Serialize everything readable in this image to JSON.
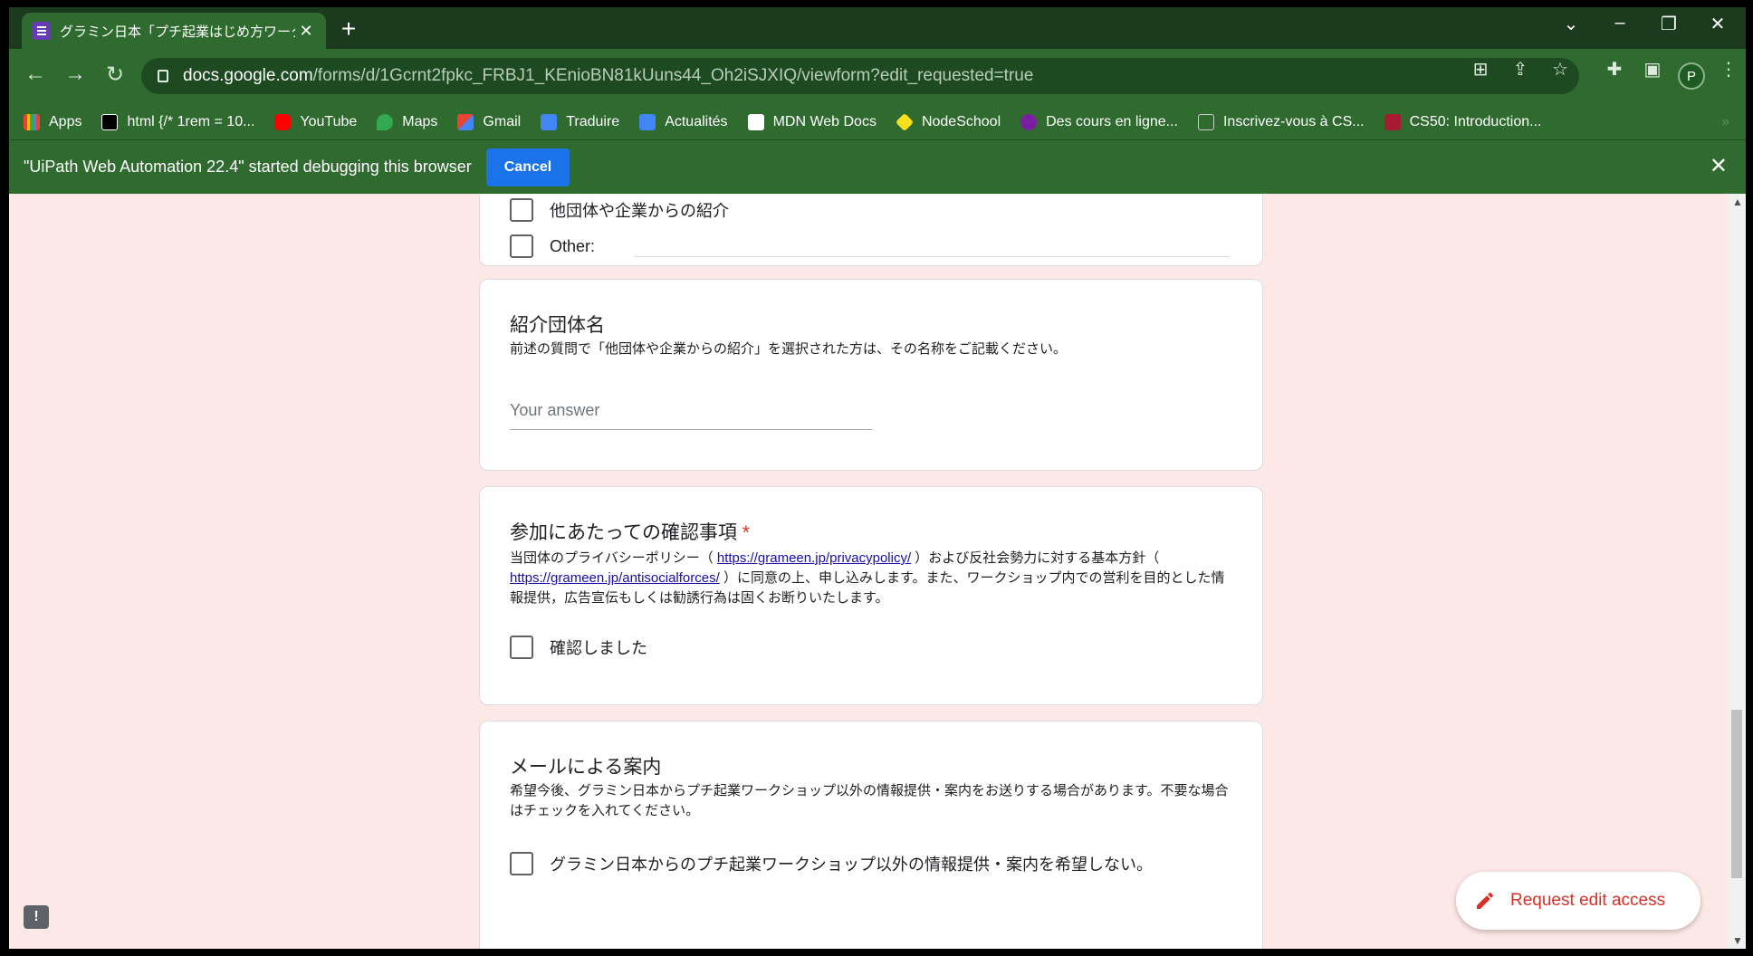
{
  "browser": {
    "tab_title": "グラミン日本「プチ起業はじめ方ワーク",
    "tab_close": "✕",
    "new_tab": "+",
    "url_host": "docs.google.com",
    "url_path": "/forms/d/1Gcrnt2fpkc_FRBJ1_KEnioBN81kUuns44_Oh2iSJXIQ/viewform?edit_requested=true",
    "profile_initial": "P",
    "icons": [
      "back-icon",
      "forward-icon",
      "reload-icon",
      "lock-icon",
      "translate-icon",
      "share-icon",
      "star-icon",
      "extensions-icon",
      "sidepanel-icon",
      "menu-icon"
    ]
  },
  "bookmarks": [
    {
      "label": "Apps",
      "color": "#ea4335"
    },
    {
      "label": "html {/* 1rem = 10...",
      "color": "#000000"
    },
    {
      "label": "YouTube",
      "color": "#ff0000"
    },
    {
      "label": "Maps",
      "color": "#34a853"
    },
    {
      "label": "Gmail",
      "color": "#ea4335"
    },
    {
      "label": "Traduire",
      "color": "#4285f4"
    },
    {
      "label": "Actualités",
      "color": "#4285f4"
    },
    {
      "label": "MDN Web Docs",
      "color": "#000000"
    },
    {
      "label": "NodeSchool",
      "color": "#f7df1e"
    },
    {
      "label": "Des cours en ligne...",
      "color": "#7b1fa2"
    },
    {
      "label": "Inscrivez-vous à CS...",
      "color": "#2f6b2f"
    },
    {
      "label": "CS50: Introduction...",
      "color": "#a51c30"
    }
  ],
  "bookmarks_more": "»",
  "infobar": {
    "message": "\"UiPath Web Automation 22.4\" started debugging this browser",
    "cancel": "Cancel",
    "close": "✕"
  },
  "form": {
    "card1": {
      "option1": "他団体や企業からの紹介",
      "other_label": "Other:"
    },
    "card2": {
      "title": "紹介団体名",
      "description": "前述の質問で「他団体や企業からの紹介」を選択された方は、その名称をご記載ください。",
      "placeholder": "Your answer"
    },
    "card3": {
      "title": "参加にあたっての確認事項",
      "required_mark": "*",
      "desc_part1": " 当団体のプライバシーポリシー（ ",
      "link1": "https://grameen.jp/privacypolicy/",
      "desc_part2": " ）および反社会勢力に対する基本方針（ ",
      "link2": "https://grameen.jp/antisocialforces/",
      "desc_part3": " ）に同意の上、申し込みします。また、ワークショップ内での営利を目的とした情報提供，広告宣伝もしくは勧誘行為は固くお断りいたします。",
      "checkbox_label": "確認しました"
    },
    "card4": {
      "title": "メールによる案内",
      "description": "希望今後、グラミン日本からプチ起業ワークショップ以外の情報提供・案内をお送りする場合があります。不要な場合はチェックを入れてください。",
      "checkbox_label": "グラミン日本からのプチ起業ワークショップ以外の情報提供・案内を希望しない。"
    }
  },
  "fab": {
    "label": "Request edit access"
  },
  "feedback": "!",
  "colors": {
    "accent": "#d93025",
    "link": "#1a0dab",
    "page_bg": "#fce8e6",
    "chrome": "#2f6b2f"
  }
}
